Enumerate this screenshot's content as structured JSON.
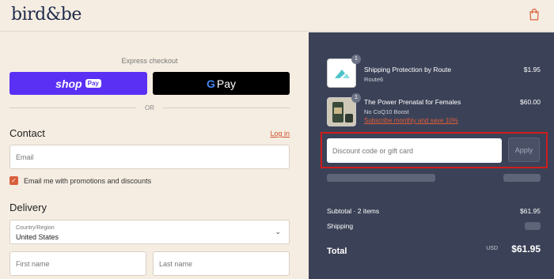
{
  "header": {
    "logo": "bird&be",
    "cart_icon": "shopping-bag-icon"
  },
  "express": {
    "label": "Express checkout",
    "shop_label": "shop",
    "shop_pay_badge": "Pay",
    "gpay_g": "G",
    "gpay_label": "Pay",
    "divider_text": "OR"
  },
  "contact": {
    "heading": "Contact",
    "login_link": "Log in",
    "email_placeholder": "Email",
    "promo_checkbox_label": "Email me with promotions and discounts",
    "promo_checked": true
  },
  "delivery": {
    "heading": "Delivery",
    "country_label": "Country/Region",
    "country_value": "United States",
    "first_name_placeholder": "First name",
    "last_name_placeholder": "Last name"
  },
  "order": {
    "items": [
      {
        "title": "Shipping Protection by Route",
        "subtitle": "Route6",
        "quantity": "1",
        "price": "$1.95"
      },
      {
        "title": "The Power Prenatal for Females",
        "subtitle": "No CoQ10 Boost",
        "link": "Subscribe monthly and save 10%",
        "quantity": "1",
        "price": "$60.00"
      }
    ],
    "discount_placeholder": "Discount code or gift card",
    "apply_label": "Apply",
    "subtotal_label": "Subtotal · 2 items",
    "subtotal_value": "$61.95",
    "shipping_label": "Shipping",
    "total_label": "Total",
    "total_currency": "USD",
    "total_value": "$61.95"
  },
  "colors": {
    "accent": "#d9603b",
    "shop_pay": "#5a31f4",
    "summary_bg": "#3b4257",
    "highlight": "#d01c1c"
  }
}
